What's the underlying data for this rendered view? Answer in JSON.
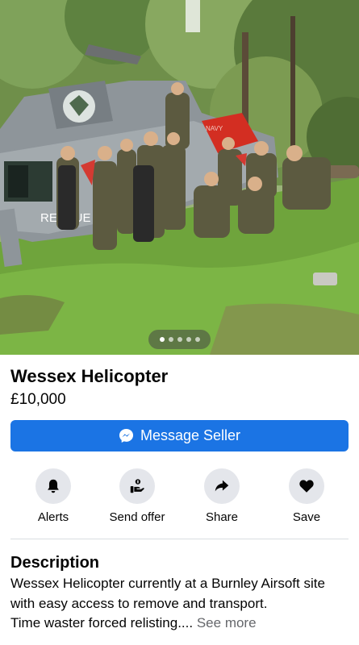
{
  "photo": {
    "subject": "Wessex helicopter with airsoft players",
    "helicopter_text": "RESCUE",
    "tail_text": "NAVY",
    "carousel": {
      "count": 5,
      "active_index": 0
    }
  },
  "listing": {
    "title": "Wessex Helicopter",
    "price": "£10,000"
  },
  "message_button": {
    "label": "Message Seller",
    "icon": "messenger-icon",
    "color": "#1b74e4"
  },
  "actions": [
    {
      "label": "Alerts",
      "icon": "bell-icon"
    },
    {
      "label": "Send offer",
      "icon": "offer-hand-icon"
    },
    {
      "label": "Share",
      "icon": "share-arrow-icon"
    },
    {
      "label": "Save",
      "icon": "heart-icon"
    }
  ],
  "description": {
    "heading": "Description",
    "lines": [
      "Wessex Helicopter currently at a Burnley Airsoft site",
      "with easy access to remove and transport.",
      "Time waster forced relisting...."
    ],
    "see_more": "See more"
  }
}
